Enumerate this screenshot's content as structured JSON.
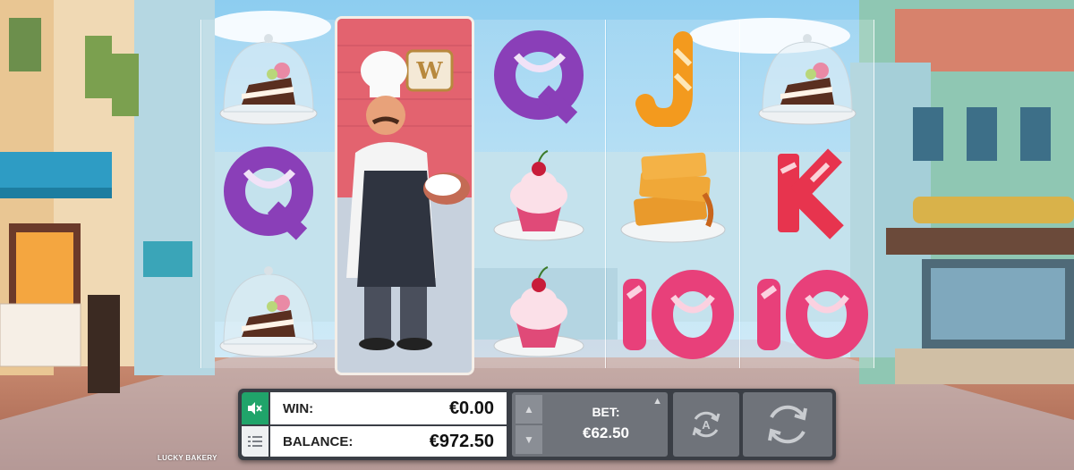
{
  "game": {
    "title": "LUCKY BAKERY"
  },
  "reels": {
    "wild_badge": "W",
    "columns": [
      [
        "cake-dome",
        "letter-q",
        "cake-dome"
      ],
      [
        "chef-wild"
      ],
      [
        "letter-q",
        "cupcake",
        "cupcake"
      ],
      [
        "letter-j",
        "waffles",
        "number-10"
      ],
      [
        "cake-dome",
        "letter-k",
        "number-10"
      ]
    ],
    "letters": {
      "q": "Q",
      "j": "J",
      "k": "K",
      "ten": "10"
    }
  },
  "panel": {
    "win_label": "WIN:",
    "win_value": "€0.00",
    "balance_label": "BALANCE:",
    "balance_value": "€972.50",
    "bet_label": "BET:",
    "bet_value": "€62.50"
  },
  "icons": {
    "sound": "speaker-muted-icon",
    "menu": "menu-list-icon",
    "bet_up": "chevron-up-icon",
    "bet_down": "chevron-down-icon",
    "autoplay": "autoplay-icon",
    "spin": "spin-icon"
  },
  "colors": {
    "accent_green": "#20a46a",
    "panel_dark": "#3a3e45",
    "panel_button": "#6f737a"
  }
}
